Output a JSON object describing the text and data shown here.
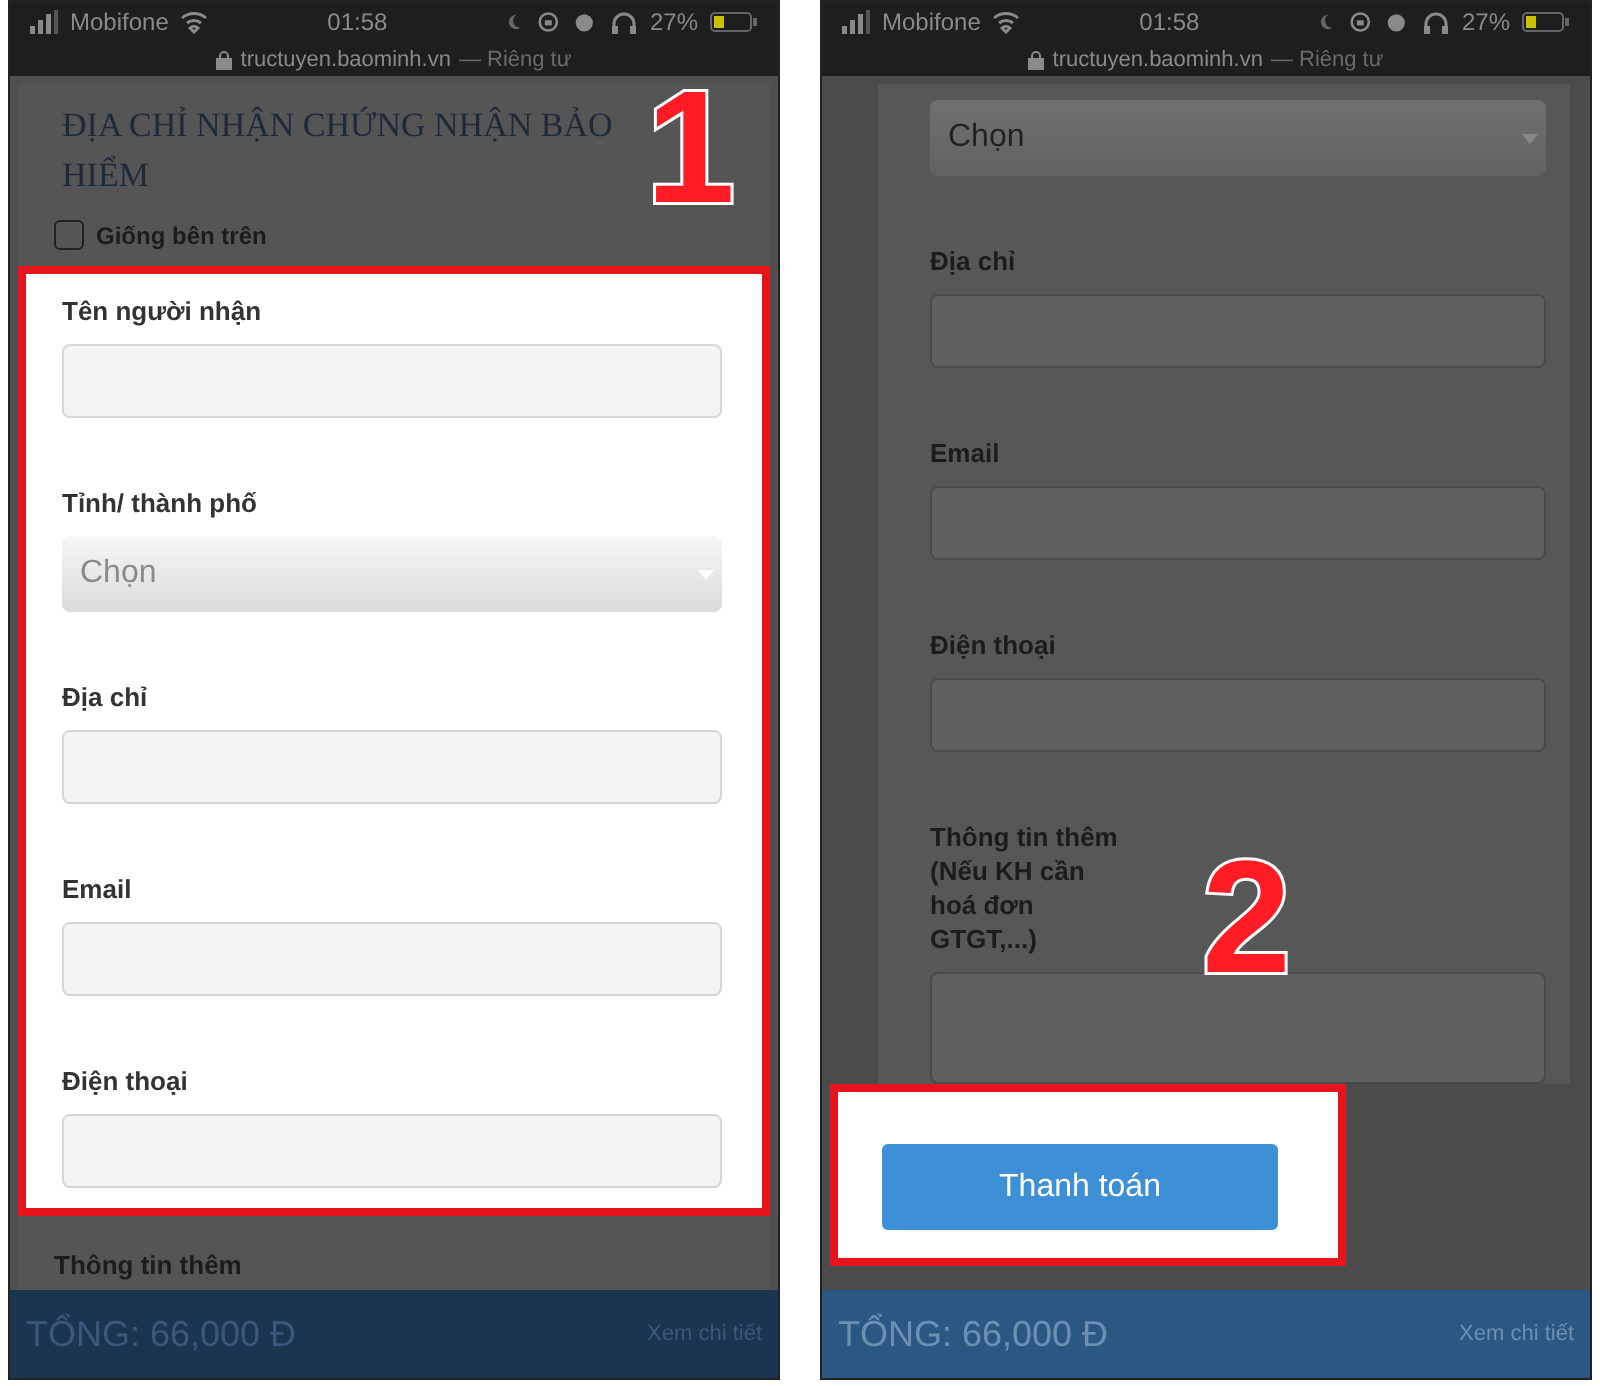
{
  "phones": [
    {
      "status": {
        "carrier": "Mobifone",
        "time": "01:58",
        "battery": "27%"
      },
      "url": {
        "host": "tructuyen.baominh.vn",
        "note": "— Riêng tư"
      },
      "number": "1",
      "sections": [
        {
          "highlighted": false,
          "items": [
            {
              "kind": "heading",
              "text": "ĐỊA CHỈ NHẬN CHỨNG NHẬN BẢO HIỂM"
            },
            {
              "kind": "checkbox",
              "label": "Giống bên trên",
              "checked": false
            }
          ]
        },
        {
          "highlighted": true,
          "items": [
            {
              "kind": "field",
              "label": "Tên người nhận"
            },
            {
              "kind": "select",
              "label": "Tỉnh/ thành phố",
              "value": "Chọn"
            },
            {
              "kind": "field",
              "label": "Địa chỉ"
            },
            {
              "kind": "field",
              "label": "Email"
            },
            {
              "kind": "field",
              "label": "Điện thoại"
            }
          ]
        },
        {
          "highlighted": false,
          "items": [
            {
              "kind": "label",
              "label": "Thông tin thêm"
            }
          ]
        }
      ],
      "footer": {
        "total": "TỔNG: 66,000 Đ",
        "link": "Xem chi tiết"
      }
    },
    {
      "status": {
        "carrier": "Mobifone",
        "time": "01:58",
        "battery": "27%"
      },
      "url": {
        "host": "tructuyen.baominh.vn",
        "note": "— Riêng tư"
      },
      "number": "2",
      "sections": [
        {
          "highlighted": false,
          "items": [
            {
              "kind": "select",
              "value": "Chọn"
            },
            {
              "kind": "field",
              "label": "Địa chỉ"
            },
            {
              "kind": "field",
              "label": "Email"
            },
            {
              "kind": "field",
              "label": "Điện thoại"
            },
            {
              "kind": "textarea",
              "label": "Thông tin thêm (Nếu KH cần hoá đơn GTGT,...)"
            }
          ]
        },
        {
          "highlighted": true,
          "items": [
            {
              "kind": "button",
              "label": "Thanh toán"
            }
          ]
        }
      ],
      "footer": {
        "total": "TỔNG: 66,000 Đ",
        "link": "Xem chi tiết"
      }
    }
  ]
}
